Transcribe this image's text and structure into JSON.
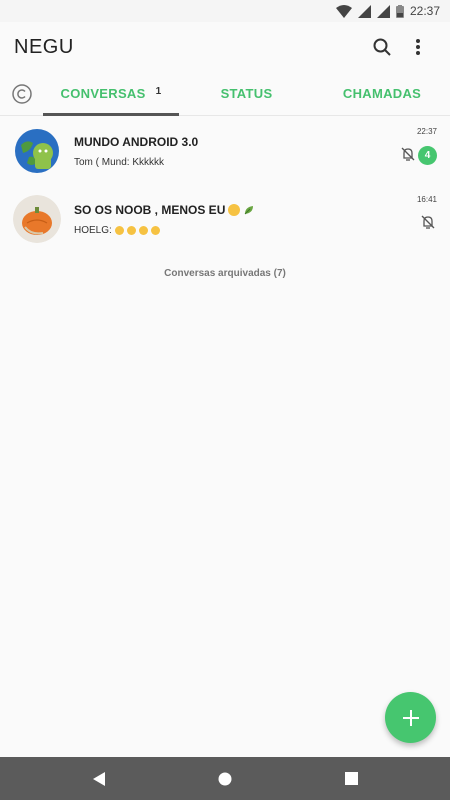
{
  "status_bar": {
    "time": "22:37"
  },
  "app_bar": {
    "title": "NEGU"
  },
  "tabs": [
    {
      "label": "CONVERSAS",
      "badge": "1",
      "active": true
    },
    {
      "label": "STATUS",
      "active": false
    },
    {
      "label": "CHAMADAS",
      "active": false
    }
  ],
  "chats": [
    {
      "name": "MUNDO ANDROID 3.0",
      "message": "Tom ( Mund: Kkkkkk",
      "time": "22:37",
      "unread": "4",
      "muted": true,
      "avatar_icon": "globe-android-avatar"
    },
    {
      "name": "SO OS NOOB , MENOS EU",
      "message": "HOELG: ",
      "time": "16:41",
      "muted": true,
      "avatar_icon": "pumpkin-avatar"
    }
  ],
  "archived_label": "Conversas arquivadas (7)",
  "colors": {
    "accent": "#45c06e",
    "fab": "#46c66f",
    "navbar": "#5b5b5b",
    "background": "#fafafa"
  }
}
